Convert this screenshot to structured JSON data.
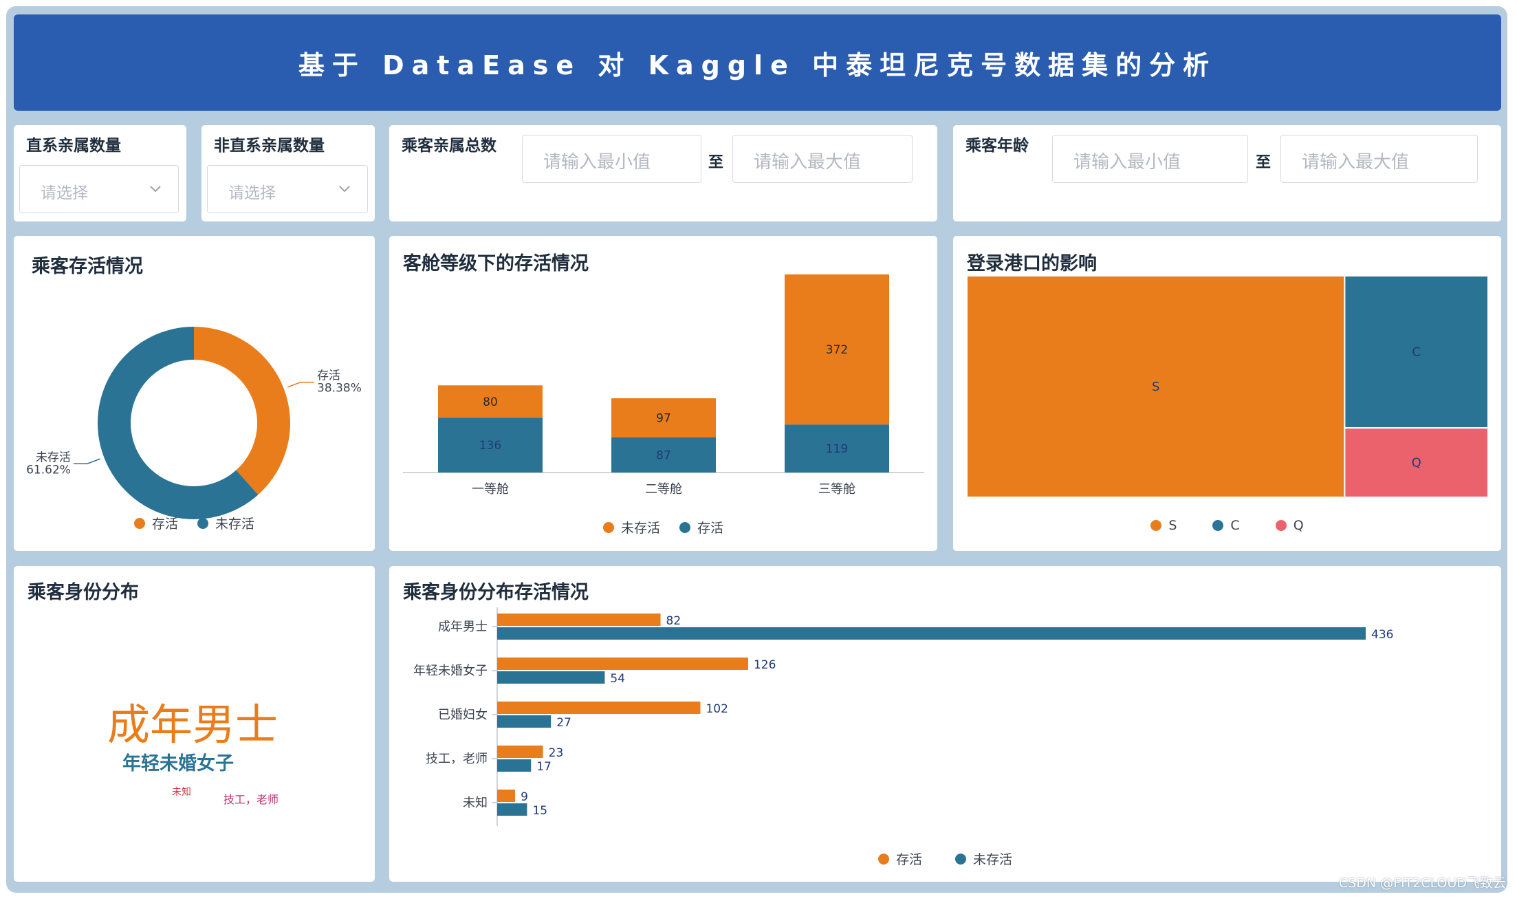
{
  "header": {
    "title": "基于 DataEase 对 Kaggle 中泰坦尼克号数据集的分析"
  },
  "filters": {
    "direct_relatives": {
      "label": "直系亲属数量",
      "placeholder": "请选择"
    },
    "indirect_relatives": {
      "label": "非直系亲属数量",
      "placeholder": "请选择"
    },
    "total_relatives": {
      "label": "乘客亲属总数",
      "min_placeholder": "请输入最小值",
      "to": "至",
      "max_placeholder": "请输入最大值"
    },
    "age": {
      "label": "乘客年龄",
      "min_placeholder": "请输入最小值",
      "to": "至",
      "max_placeholder": "请输入最大值"
    }
  },
  "colors": {
    "orange": "#e97d1b",
    "teal": "#2b7394",
    "pink": "#eb626d",
    "banner": "#2a5db0"
  },
  "survival": {
    "title": "乘客存活情况",
    "chart_data": {
      "type": "pie",
      "slices": [
        {
          "name": "存活",
          "pct": 38.38,
          "label": "38.38%"
        },
        {
          "name": "未存活",
          "pct": 61.62,
          "label": "61.62%"
        }
      ],
      "legend": [
        "存活",
        "未存活"
      ]
    }
  },
  "class_survival": {
    "title": "客舱等级下的存活情况",
    "chart_data": {
      "type": "bar",
      "stacked": true,
      "categories": [
        "一等舱",
        "二等舱",
        "三等舱"
      ],
      "series": [
        {
          "name": "存活",
          "values": [
            136,
            87,
            119
          ]
        },
        {
          "name": "未存活",
          "values": [
            80,
            97,
            372
          ]
        }
      ],
      "legend": [
        "未存活",
        "存活"
      ]
    }
  },
  "port": {
    "title": "登录港口的影响",
    "chart_data": {
      "type": "treemap",
      "nodes": [
        {
          "name": "S",
          "share": 0.7248
        },
        {
          "name": "C",
          "share": 0.189
        },
        {
          "name": "Q",
          "share": 0.0862
        }
      ],
      "legend": [
        "S",
        "C",
        "Q"
      ]
    }
  },
  "identity": {
    "title": "乘客身份分布",
    "words": [
      {
        "text": "成年男士"
      },
      {
        "text": "年轻未婚女子"
      },
      {
        "text": "未知"
      },
      {
        "text": "技工，老师"
      }
    ]
  },
  "identity_survival": {
    "title": "乘客身份分布存活情况",
    "chart_data": {
      "type": "bar",
      "orientation": "horizontal",
      "categories": [
        "成年男士",
        "年轻未婚女子",
        "已婚妇女",
        "技工，老师",
        "未知"
      ],
      "series": [
        {
          "name": "存活",
          "values": [
            82,
            126,
            102,
            23,
            9
          ]
        },
        {
          "name": "未存活",
          "values": [
            436,
            54,
            27,
            17,
            15
          ]
        }
      ],
      "legend": [
        "存活",
        "未存活"
      ]
    }
  },
  "watermark": "CSDN @FIT2CLOUD飞致云"
}
